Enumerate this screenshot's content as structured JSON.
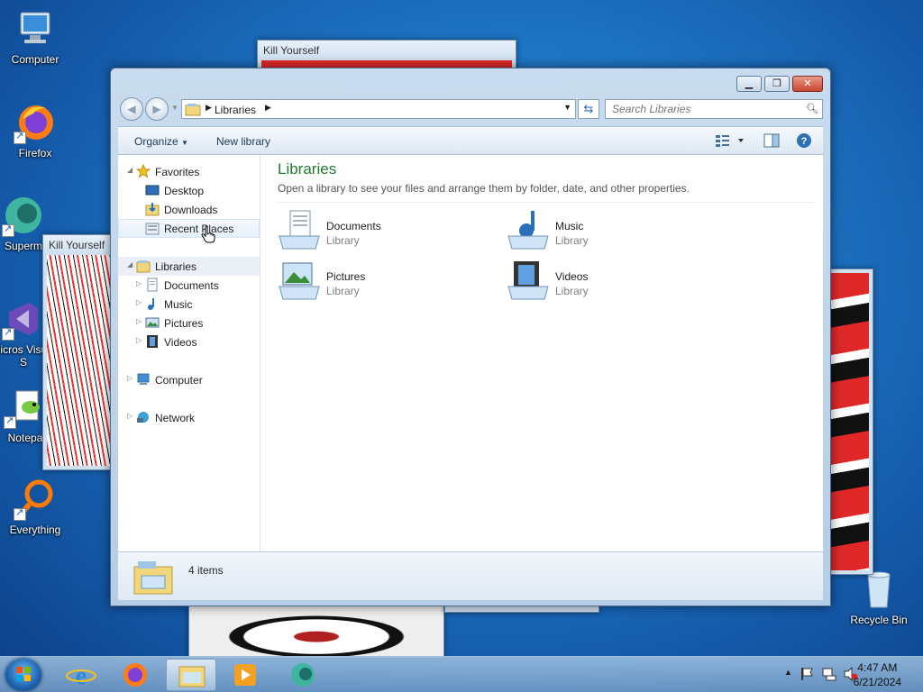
{
  "desktop": {
    "icons": [
      {
        "label": "Computer"
      },
      {
        "label": "Firefox"
      },
      {
        "label": "Superm"
      },
      {
        "label": "Micros Visual S"
      },
      {
        "label": "Notepa"
      },
      {
        "label": "Everything"
      },
      {
        "label": "Recycle Bin"
      }
    ]
  },
  "background_windows": [
    {
      "title": "Kill Yourself"
    },
    {
      "title": "Kill Yourself"
    }
  ],
  "explorer": {
    "address": {
      "crumb": "Libraries"
    },
    "search": {
      "placeholder": "Search Libraries"
    },
    "toolbar": {
      "organize": "Organize",
      "new_library": "New library"
    },
    "nav": {
      "favorites": {
        "label": "Favorites",
        "items": [
          "Desktop",
          "Downloads",
          "Recent Places"
        ]
      },
      "libraries": {
        "label": "Libraries",
        "items": [
          "Documents",
          "Music",
          "Pictures",
          "Videos"
        ]
      },
      "computer": "Computer",
      "network": "Network"
    },
    "main": {
      "title": "Libraries",
      "subtitle": "Open a library to see your files and arrange them by folder, date, and other properties.",
      "items": [
        {
          "name": "Documents",
          "type": "Library"
        },
        {
          "name": "Music",
          "type": "Library"
        },
        {
          "name": "Pictures",
          "type": "Library"
        },
        {
          "name": "Videos",
          "type": "Library"
        }
      ]
    },
    "details": {
      "count": "4 items"
    }
  },
  "taskbar": {
    "clock": {
      "time": "4:47 AM",
      "date": "6/21/2024"
    }
  }
}
